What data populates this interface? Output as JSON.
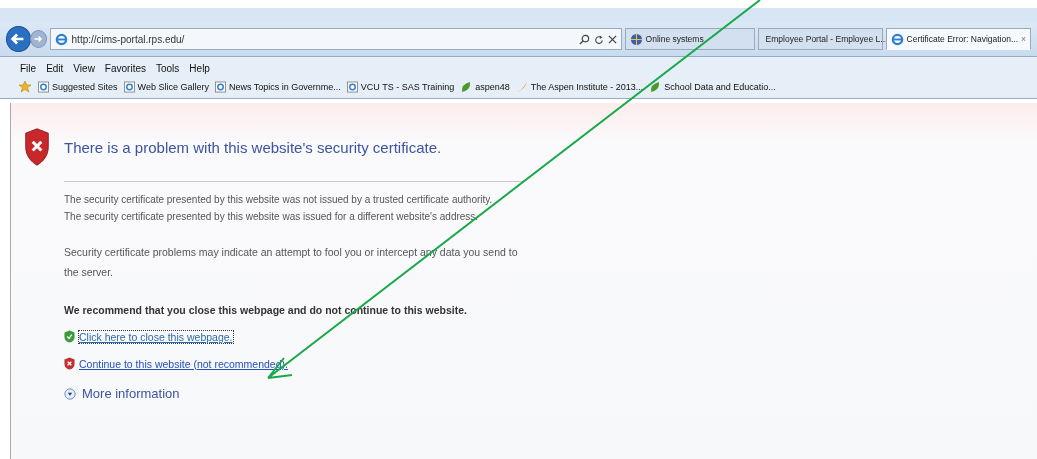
{
  "address_bar": {
    "url": "http://cims-portal.rps.edu/"
  },
  "tabs": [
    {
      "label": "Online systems",
      "selected": false
    },
    {
      "label": "Employee Portal - Employee L...",
      "selected": false
    },
    {
      "label": "Certificate Error: Navigation...",
      "selected": true,
      "close": "×"
    }
  ],
  "menu_bar": [
    "File",
    "Edit",
    "View",
    "Favorites",
    "Tools",
    "Help"
  ],
  "favorites": [
    "Suggested Sites",
    "Web Slice Gallery",
    "News Topics in Governme...",
    "VCU TS - SAS Training",
    "aspen48",
    "The Aspen Institute - 2013...",
    "School Data and Educatio..."
  ],
  "page": {
    "heading": "There is a problem with this website's security certificate.",
    "reasons": [
      "The security certificate presented by this website was not issued by a trusted certificate authority.",
      "The security certificate presented by this website was issued for a different website's address."
    ],
    "warning": "Security certificate problems may indicate an attempt to fool you or intercept any data you send to the server.",
    "recommendation": "We recommend that you close this webpage and do not continue to this website.",
    "links": [
      {
        "label": "Click here to close this webpage.",
        "kind": "safe",
        "focused": true
      },
      {
        "label": "Continue to this website (not recommended).",
        "kind": "unsafe",
        "focused": false
      }
    ],
    "more": "More information"
  }
}
